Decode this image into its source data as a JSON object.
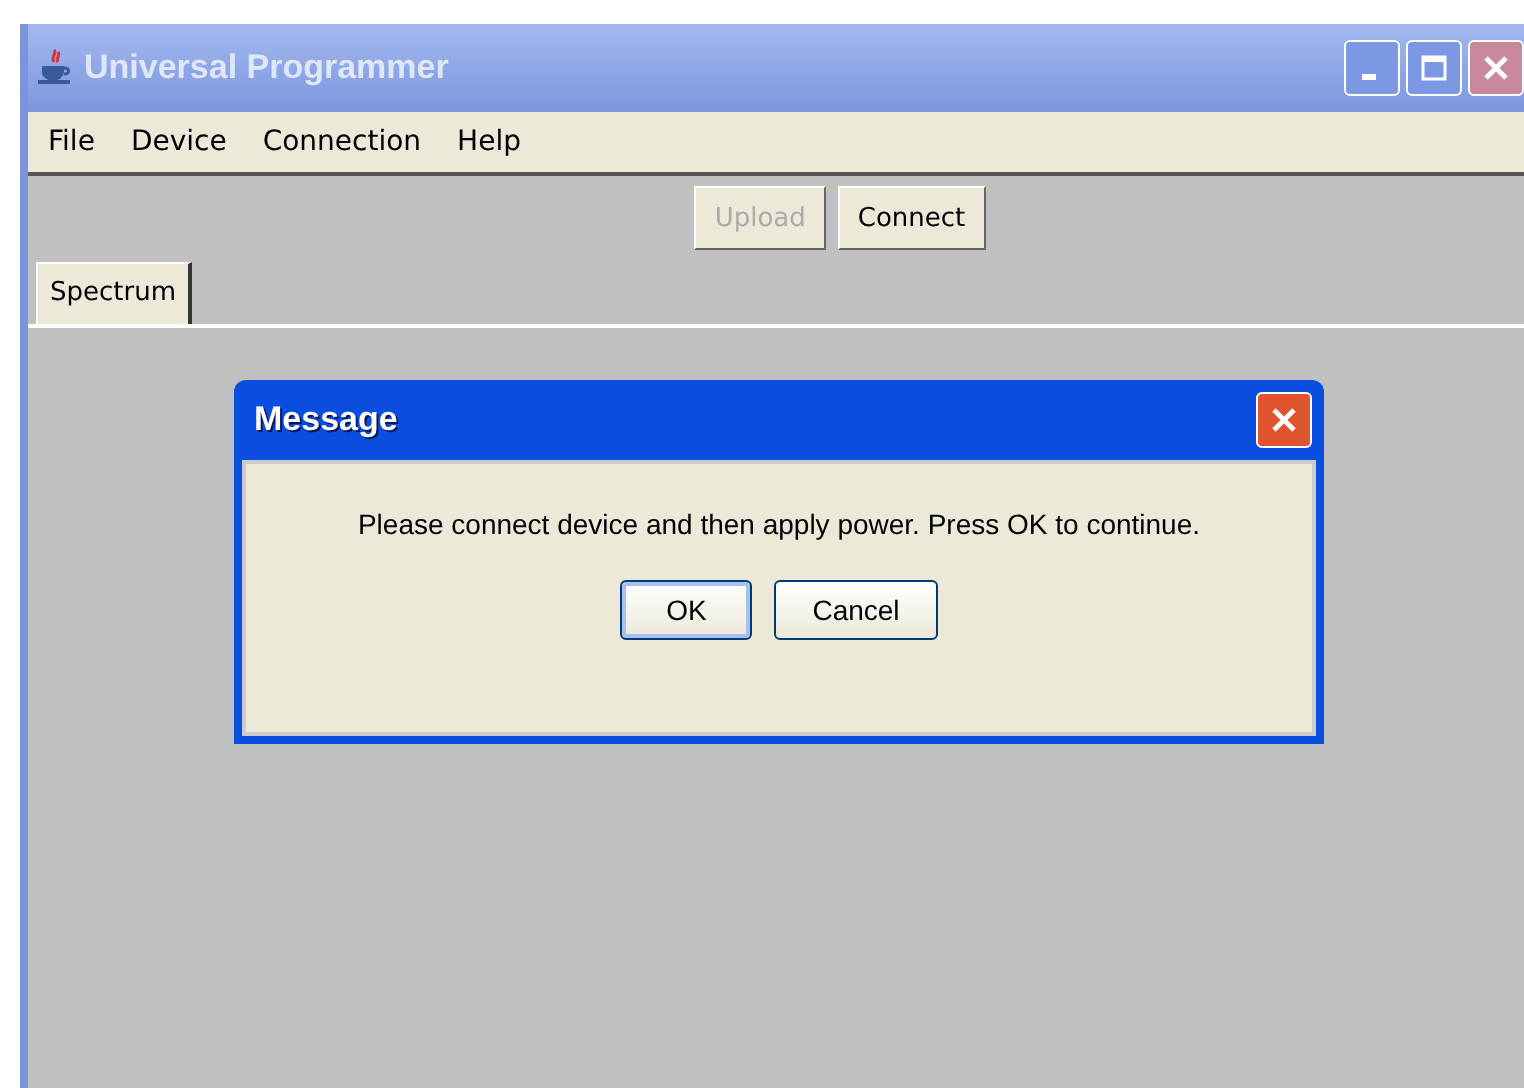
{
  "window": {
    "title": "Universal Programmer",
    "active": false
  },
  "menu": [
    {
      "label": "File"
    },
    {
      "label": "Device"
    },
    {
      "label": "Connection"
    },
    {
      "label": "Help"
    }
  ],
  "toolbar": [
    {
      "label": "Upload",
      "disabled": true
    },
    {
      "label": "Connect",
      "disabled": false
    }
  ],
  "tabs": [
    {
      "label": "Spectrum",
      "selected": true
    }
  ],
  "dialog": {
    "title": "Message",
    "message": "Please connect device and then apply power. Press OK to continue.",
    "buttons": [
      {
        "label": "OK",
        "default": true
      },
      {
        "label": "Cancel",
        "default": false
      }
    ]
  }
}
